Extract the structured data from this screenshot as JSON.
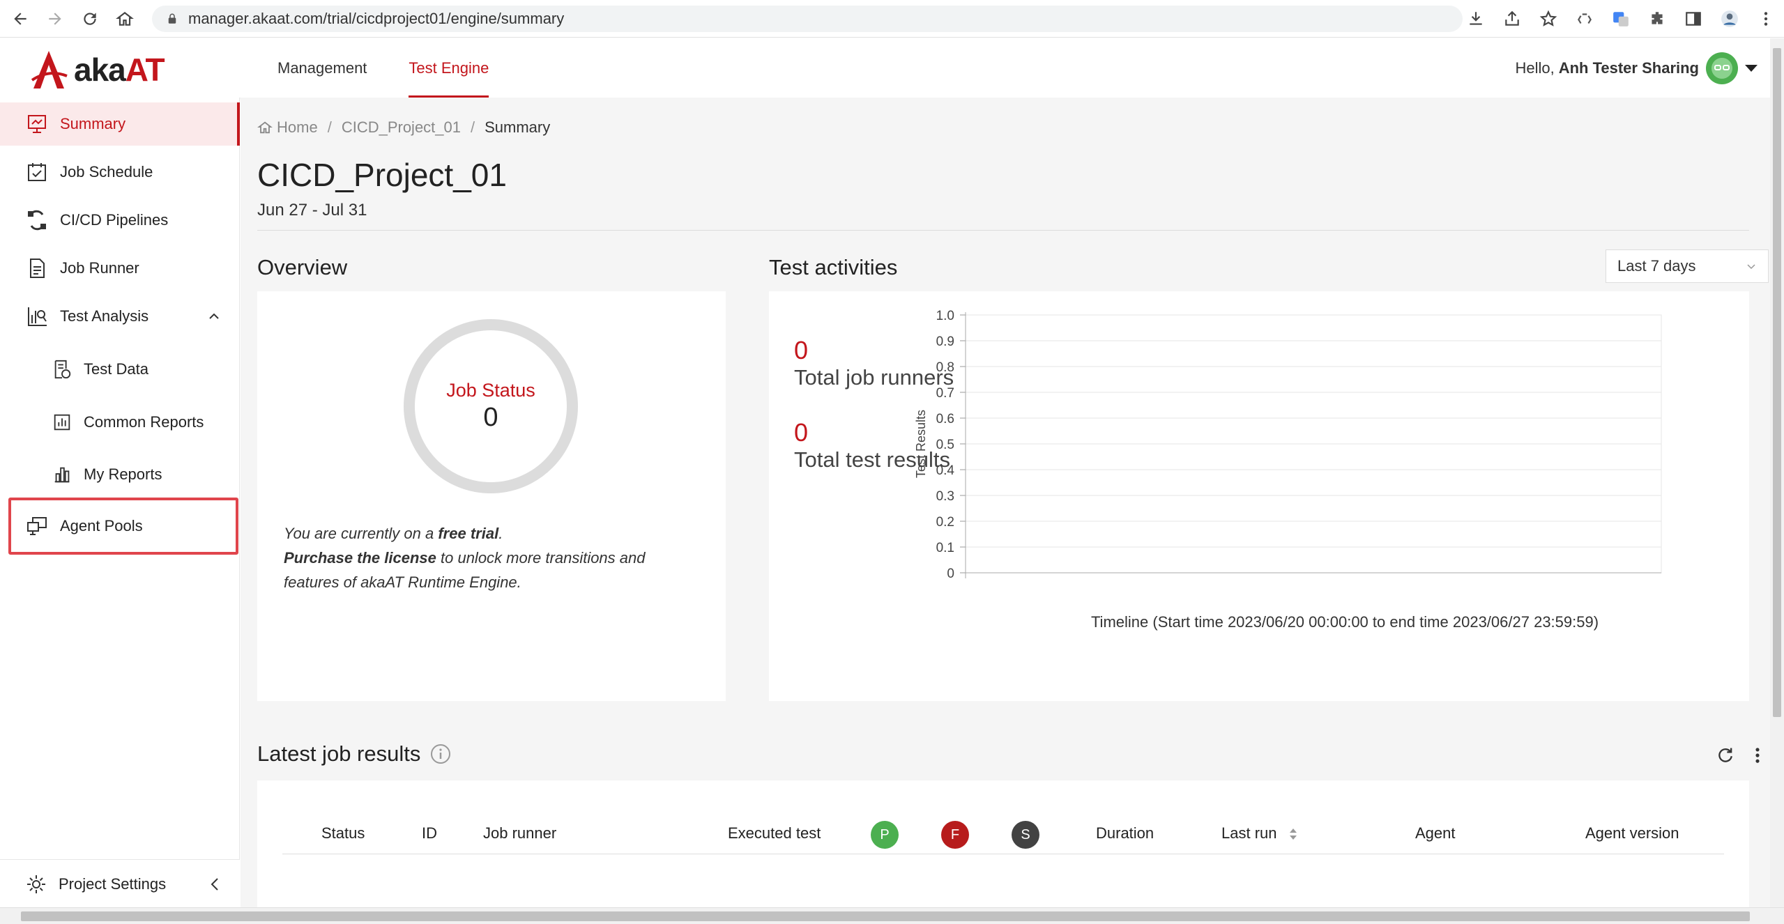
{
  "browser": {
    "url": "manager.akaat.com/trial/cicdproject01/engine/summary"
  },
  "header": {
    "logo_prefix": "aka",
    "logo_suffix": "AT",
    "nav": [
      {
        "label": "Management",
        "active": false
      },
      {
        "label": "Test Engine",
        "active": true
      }
    ],
    "greeting": "Hello,",
    "user_name": "Anh Tester Sharing"
  },
  "sidebar": {
    "items": [
      {
        "label": "Summary",
        "icon": "summary-icon",
        "active": true
      },
      {
        "label": "Job Schedule",
        "icon": "calendar-check-icon"
      },
      {
        "label": "CI/CD Pipelines",
        "icon": "pipeline-icon"
      },
      {
        "label": "Job Runner",
        "icon": "document-icon"
      },
      {
        "label": "Test Analysis",
        "icon": "analysis-icon",
        "expanded": true
      },
      {
        "label": "Test Data",
        "icon": "test-data-icon"
      },
      {
        "label": "Common Reports",
        "icon": "report-icon"
      },
      {
        "label": "My Reports",
        "icon": "my-report-icon"
      },
      {
        "label": "Agent Pools",
        "icon": "agent-pools-icon",
        "highlighted": true
      }
    ],
    "project_settings": "Project Settings"
  },
  "breadcrumb": {
    "home": "Home",
    "project": "CICD_Project_01",
    "current": "Summary"
  },
  "page": {
    "title": "CICD_Project_01",
    "date_range": "Jun 27 - Jul 31"
  },
  "overview": {
    "title": "Overview",
    "job_status_label": "Job Status",
    "job_status_value": "0",
    "trial_line1_prefix": "You are currently on a ",
    "trial_line1_bold": "free trial",
    "trial_line1_suffix": ".",
    "trial_line2_bold": "Purchase the license",
    "trial_line2_rest": " to unlock more transitions and features of akaAT Runtime Engine."
  },
  "activities": {
    "title": "Test activities",
    "period": "Last 7 days",
    "total_job_runners_value": "0",
    "total_job_runners_label": "Total job runners",
    "total_test_results_value": "0",
    "total_test_results_label": "Total test results"
  },
  "chart_data": {
    "type": "line",
    "title": "",
    "ylabel": "Test Results",
    "xlabel": "Timeline (Start time 2023/06/20 00:00:00 to end time 2023/06/27 23:59:59)",
    "ylim": [
      0,
      1.0
    ],
    "y_ticks": [
      "1.0",
      "0.9",
      "0.8",
      "0.7",
      "0.6",
      "0.5",
      "0.4",
      "0.3",
      "0.2",
      "0.1",
      "0"
    ],
    "series": [],
    "grid": true
  },
  "jobs": {
    "title": "Latest job results",
    "columns": {
      "status": "Status",
      "id": "ID",
      "job_runner": "Job runner",
      "executed_test": "Executed test",
      "passed": "P",
      "failed": "F",
      "skipped": "S",
      "duration": "Duration",
      "last_run": "Last run",
      "agent": "Agent",
      "agent_version": "Agent version"
    },
    "colors": {
      "passed": "#4caf50",
      "failed": "#b71c1c",
      "skipped": "#424242"
    }
  },
  "colors": {
    "accent": "#c3161c",
    "highlight": "#e0454c"
  }
}
